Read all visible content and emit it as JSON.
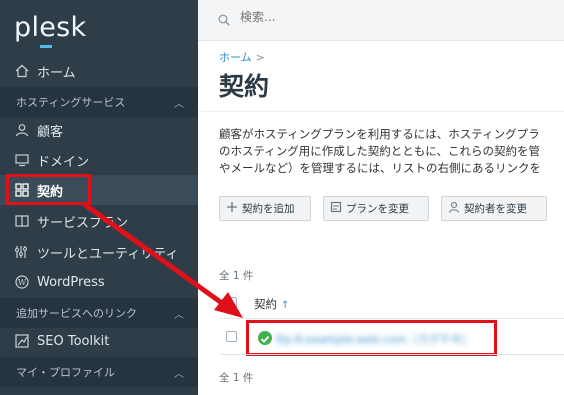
{
  "logo": {
    "text_1": "pl",
    "text_2": "e",
    "text_3": "sk"
  },
  "sidebar": {
    "home": "ホーム",
    "hosting_section": "ホスティングサービス",
    "items": [
      {
        "label": "顧客",
        "icon": "user-icon"
      },
      {
        "label": "ドメイン",
        "icon": "monitor-icon"
      },
      {
        "label": "契約",
        "icon": "grid-icon"
      },
      {
        "label": "サービスプラン",
        "icon": "book-icon"
      },
      {
        "label": "ツールとユーティリティ",
        "icon": "tools-icon"
      },
      {
        "label": "WordPress",
        "icon": "wordpress-icon"
      }
    ],
    "addon_section": "追加サービスへのリンク",
    "seo": "SEO Toolkit",
    "profile_section": "マイ・プロファイル"
  },
  "search": {
    "placeholder": "検索..."
  },
  "breadcrumb": {
    "home": "ホーム",
    "sep": ">"
  },
  "page_title": "契約",
  "description": [
    "顧客がホスティングプランを利用するには、ホスティングプラ",
    "のホスティング用に作成した契約とともに、これらの契約を管",
    "やメールなど）を管理するには、リストの右側にあるリンクを"
  ],
  "toolbar": {
    "add": "契約を追加",
    "change_plan": "プランを変更",
    "change_owner": "契約者を変更"
  },
  "list": {
    "count": "全 1 件",
    "column": "契約",
    "sort_arrow": "↑",
    "rows": [
      {
        "name": "ftp-8.example-web.com（ラグテキ）",
        "status": "ok"
      }
    ],
    "count_bottom": "全 1 件"
  },
  "colors": {
    "accent": "#2e8bc9",
    "highlight": "#e0101a",
    "sidebar": "#2e3d48",
    "ok": "#44b14f"
  }
}
